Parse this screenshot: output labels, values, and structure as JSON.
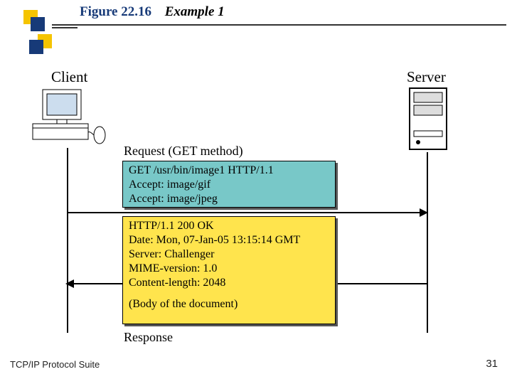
{
  "header": {
    "figure_number": "Figure 22.16",
    "figure_title": "Example 1"
  },
  "diagram": {
    "client_label": "Client",
    "server_label": "Server",
    "request_label": "Request (GET method)",
    "response_label": "Response",
    "request_box": {
      "line1": "GET   /usr/bin/image1  HTTP/1.1",
      "line2": "Accept: image/gif",
      "line3": "Accept: image/jpeg"
    },
    "response_box": {
      "line1": "HTTP/1.1   200  OK",
      "line2": "Date: Mon, 07-Jan-05 13:15:14 GMT",
      "line3": "Server: Challenger",
      "line4": "MIME-version: 1.0",
      "line5": "Content-length: 2048",
      "body": "(Body of the document)"
    }
  },
  "footer": {
    "left": "TCP/IP Protocol Suite",
    "page": "31"
  }
}
